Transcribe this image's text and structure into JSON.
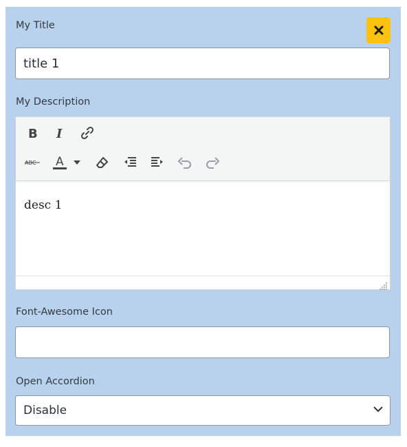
{
  "form": {
    "title_label": "My Title",
    "title_value": "title 1",
    "description_label": "My Description",
    "description_value": "desc 1",
    "icon_label": "Font-Awesome Icon",
    "icon_value": "",
    "accordion_label": "Open Accordion",
    "accordion_selected": "Disable"
  },
  "toolbar": {
    "row1": [
      "bold-icon",
      "italic-icon",
      "link-icon"
    ],
    "row2": [
      "strikethrough-icon",
      "text-color-icon",
      "text-color-dropdown-icon",
      "clear-formatting-icon",
      "outdent-icon",
      "indent-icon",
      "undo-icon",
      "redo-icon"
    ]
  },
  "colors": {
    "panel_bg": "#b8d2ed",
    "close_button_bg": "#ffc20e",
    "toolbar_bg": "#f4f5f5"
  }
}
